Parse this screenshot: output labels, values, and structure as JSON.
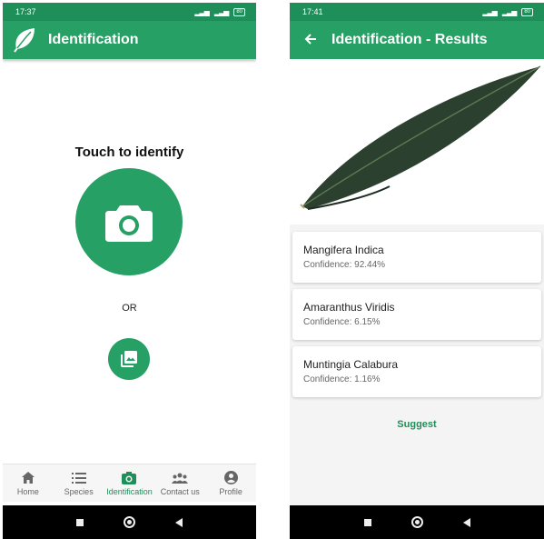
{
  "left": {
    "status": {
      "time": "17:37",
      "battery": "80"
    },
    "appbar": {
      "title": "Identification"
    },
    "main": {
      "heading": "Touch to identify",
      "or_text": "OR"
    },
    "bottom_nav": [
      {
        "label": "Home",
        "icon": "home-icon"
      },
      {
        "label": "Species",
        "icon": "list-icon"
      },
      {
        "label": "Identification",
        "icon": "camera-icon",
        "active": true
      },
      {
        "label": "Contact us",
        "icon": "people-icon"
      },
      {
        "label": "Profile",
        "icon": "account-icon"
      }
    ]
  },
  "right": {
    "status": {
      "time": "17:41",
      "battery": "80"
    },
    "appbar": {
      "title": "Identification - Results"
    },
    "results": [
      {
        "name": "Mangifera Indica",
        "confidence": "Confidence: 92.44%"
      },
      {
        "name": "Amaranthus Viridis",
        "confidence": "Confidence: 6.15%"
      },
      {
        "name": "Muntingia Calabura",
        "confidence": "Confidence: 1.16%"
      }
    ],
    "suggest_label": "Suggest"
  },
  "colors": {
    "primary": "#26a065",
    "status_bar": "#1f8f5a",
    "accent_text": "#1f8f5a"
  }
}
